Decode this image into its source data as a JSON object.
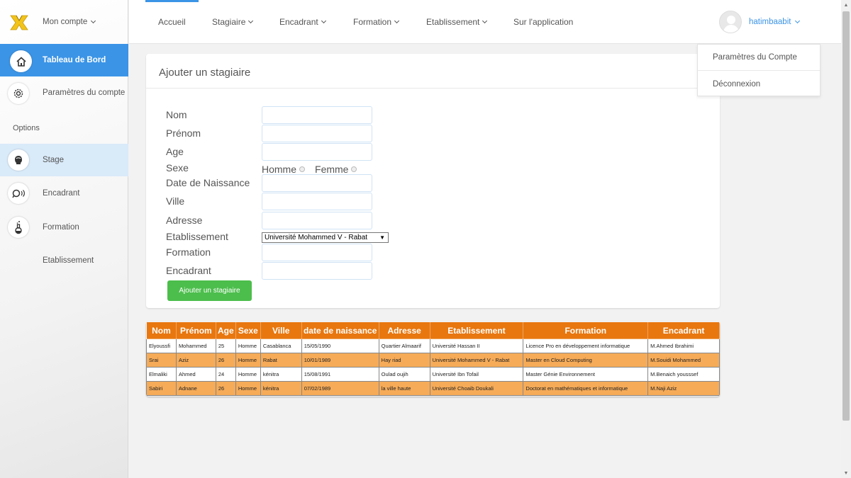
{
  "sidebar": {
    "account_label": "Mon compte",
    "items": [
      {
        "label": "Tableau de Bord",
        "icon": "home-icon"
      },
      {
        "label": "Paramètres du compte",
        "icon": "gear-icon"
      },
      {
        "label": "Stage",
        "icon": "head-icon"
      },
      {
        "label": "Encadrant",
        "icon": "speech-icon"
      },
      {
        "label": "Formation",
        "icon": "flask-icon"
      },
      {
        "label": "Etablissement",
        "icon": ""
      }
    ],
    "section_label": "Options"
  },
  "nav": {
    "items": [
      {
        "label": "Accueil",
        "dropdown": false
      },
      {
        "label": "Stagiaire",
        "dropdown": true
      },
      {
        "label": "Encadrant",
        "dropdown": true
      },
      {
        "label": "Formation",
        "dropdown": true
      },
      {
        "label": "Etablissement",
        "dropdown": true
      },
      {
        "label": "Sur l'application",
        "dropdown": false
      }
    ],
    "username": "hatimbaabit"
  },
  "user_menu": {
    "items": [
      "Paramètres du Compte",
      "Déconnexion"
    ]
  },
  "form": {
    "title": "Ajouter un stagiaire",
    "labels": {
      "nom": "Nom",
      "prenom": "Prénom",
      "age": "Age",
      "sexe": "Sexe",
      "naissance": "Date de Naissance",
      "ville": "Ville",
      "adresse": "Adresse",
      "etablissement": "Etablissement",
      "formation": "Formation",
      "encadrant": "Encadrant"
    },
    "sexe_options": [
      "Homme",
      "Femme"
    ],
    "etablissement_selected": "Université Mohammed V - Rabat",
    "submit_label": "Ajouter un stagiaire"
  },
  "table": {
    "headers": [
      "Nom",
      "Prénom",
      "Age",
      "Sexe",
      "Ville",
      "date de naissance",
      "Adresse",
      "Etablissement",
      "Formation",
      "Encadrant"
    ],
    "rows": [
      [
        "Elyoussfi",
        "Mohammed",
        "25",
        "Homme",
        "Casablanca",
        "15/05/1990",
        "Quartier Almaarif",
        "Université Hassan II",
        "Licence Pro en développement informatique",
        "M.Ahmed Ibrahimi"
      ],
      [
        "Srai",
        "Aziz",
        "26",
        "Homme",
        "Rabat",
        "10/01/1989",
        "Hay riad",
        "Université Mohammed V - Rabat",
        "Master en Cloud Computing",
        "M.Souidi Mohammed"
      ],
      [
        "Elmaliki",
        "Ahmed",
        "24",
        "Homme",
        "kénitra",
        "15/08/1991",
        "Oulad oujih",
        "Université Ibn Tofail",
        "Master Génie Environnement",
        "M.Benaich yousssef"
      ],
      [
        "Sabiri",
        "Adnane",
        "26",
        "Homme",
        "kénitra",
        "07/02/1989",
        "la ville haute",
        "Université Choaib Doukali",
        "Doctorat en mathématiques et informatique",
        "M.Naji Aziz"
      ]
    ]
  },
  "colors": {
    "accent": "#3b94e6",
    "table_header": "#e8770f",
    "table_alt_row": "#f6ab58",
    "button": "#4cbe4c"
  }
}
